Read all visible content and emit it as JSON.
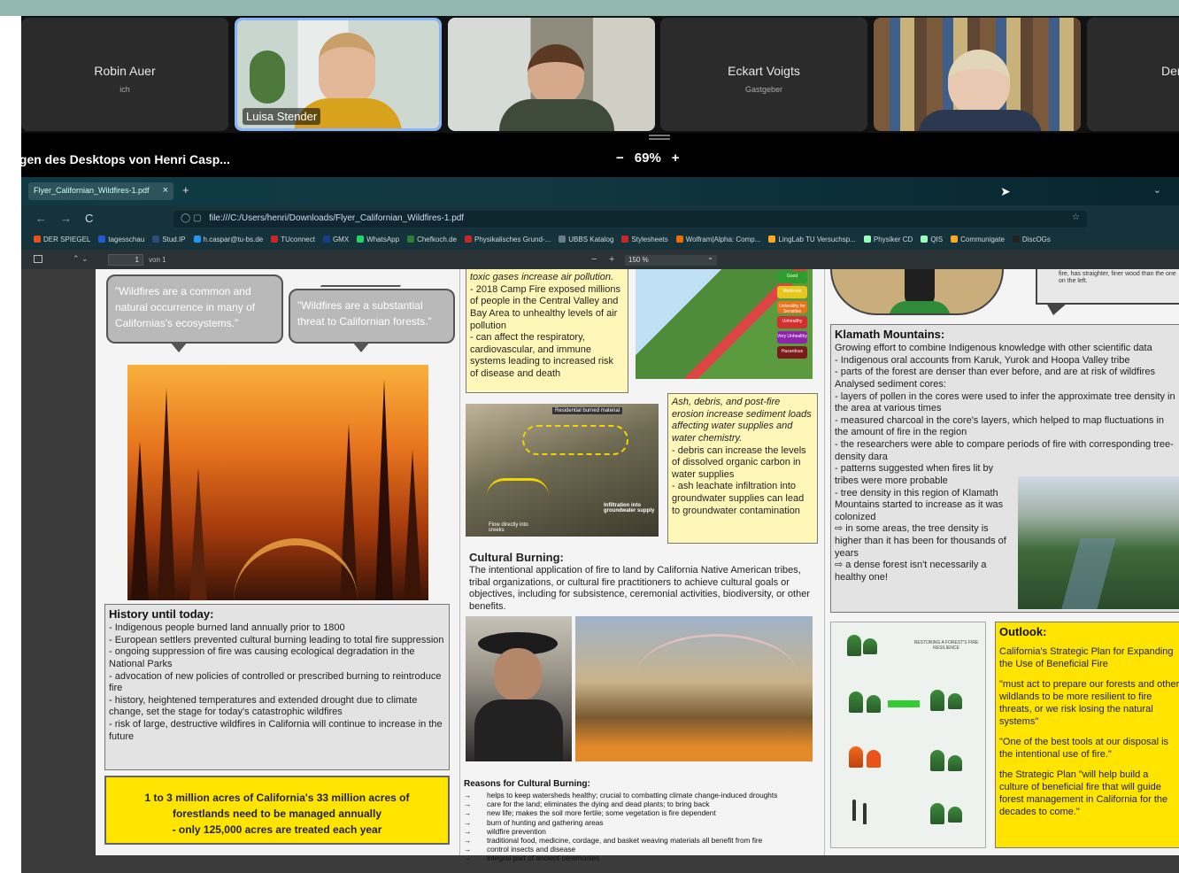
{
  "participants": [
    {
      "name": "Robin Auer",
      "role": "ich",
      "video": false
    },
    {
      "name": "Luisa Stender",
      "role": "",
      "video": true,
      "active": true
    },
    {
      "name": "",
      "role": "",
      "video": true
    },
    {
      "name": "Eckart Voigts",
      "role": "Gastgeber",
      "video": false
    },
    {
      "name": "",
      "role": "",
      "video": true
    },
    {
      "name": "Denn",
      "role": "",
      "video": false
    }
  ],
  "share": {
    "title": "igen des Desktops von Henri Casp...",
    "zoom_minus": "−",
    "zoom_value": "69%",
    "zoom_plus": "+"
  },
  "browser": {
    "tab_title": "Flyer_Californian_Wildfires-1.pdf",
    "tab_close": "×",
    "new_tab": "+",
    "url": "file:///C:/Users/henri/Downloads/Flyer_Californian_Wildfires-1.pdf",
    "back": "←",
    "forward": "→",
    "reload": "C",
    "bookmarks": [
      {
        "label": "DER SPIEGEL",
        "color": "#e0511e"
      },
      {
        "label": "tagesschau",
        "color": "#1e5bd6"
      },
      {
        "label": "Stud.IP",
        "color": "#2d4a7a"
      },
      {
        "label": "h.caspar@tu-bs.de",
        "color": "#2196f3"
      },
      {
        "label": "TUconnect",
        "color": "#c62828"
      },
      {
        "label": "GMX",
        "color": "#1a3c8b"
      },
      {
        "label": "WhatsApp",
        "color": "#25d366"
      },
      {
        "label": "Chefkoch.de",
        "color": "#2e7d32"
      },
      {
        "label": "Physikalisches Grund-...",
        "color": "#c62828"
      },
      {
        "label": "UBBS Katalog",
        "color": "#6b7d85"
      },
      {
        "label": "Stylesheets",
        "color": "#c62828"
      },
      {
        "label": "Wolfram|Alpha: Comp...",
        "color": "#ef6c00"
      },
      {
        "label": "LingLab TU Versuchsp...",
        "color": "#f9a825"
      },
      {
        "label": "Physiker CD",
        "color": "#9fb"
      },
      {
        "label": "QIS",
        "color": "#9fb"
      },
      {
        "label": "Communigate",
        "color": "#f9a825"
      },
      {
        "label": "DiscOGs",
        "color": "#222"
      }
    ]
  },
  "pdf_toolbar": {
    "page": "1",
    "page_of": "von 1",
    "zoom_minus": "−",
    "zoom_plus": "+",
    "zoom": "150 %"
  },
  "flyer": {
    "bubble1": "\"Wildfires are a common and natural occurrence in many of Californias's ecosystems.\"",
    "bubble2": "\"Wildfires are a substantial threat to Californian forests.\"",
    "history_title": "History until today:",
    "history_lines": [
      "- Indigenous people burned land annually prior to 1800",
      "- European settlers prevented cultural burning leading to total fire suppression",
      "- ongoing suppression of fire was causing ecological degradation in the National Parks",
      "- advocation of new policies of controlled or prescribed burning to reintroduce fire",
      "- history, heightened temperatures and extended drought due to climate change, set the stage for today's catastrophic wildfires",
      "- risk of large, destructive wildfires in California will continue to increase in the future"
    ],
    "acres_line1": "1 to 3 million acres of California's 33 million acres of",
    "acres_line2": "forestlands need to be managed annually",
    "acres_line3": "- only 125,000 acres are treated each year",
    "smoke_italic": "toxic gases increase air pollution.",
    "smoke_lines": [
      "- 2018 Camp Fire exposed millions of people in the Central Valley and Bay Area to unhealthy levels of air pollution",
      "- can affect the respiratory, cardiovascular, and immune systems leading to increased risk of disease and death"
    ],
    "residential_label": "Residential burned material",
    "flow_label": "Flow directly into creeks",
    "infiltration_label": "Infiltration into groundwater supply",
    "ash_italic": "Ash, debris, and post-fire erosion increase sediment loads affecting water supplies and water chemistry.",
    "ash_lines": [
      "- debris can increase the levels of dissolved organic carbon in water supplies",
      "- ash leachate infiltration into groundwater supplies can lead to groundwater contamination"
    ],
    "cultural_title": "Cultural Burning:",
    "cultural_text": "The intentional application of fire to land by California Native American tribes, tribal organizations, or cultural fire practitioners to achieve cultural goals or objectives, including for subsistence, ceremonial activities, biodiversity, or other benefits.",
    "reasons_title": "Reasons for Cultural Burning:",
    "reasons_arrow": "→",
    "reasons": [
      "helps to keep watersheds healthy; crucial to combatting climate change-induced droughts",
      "care for the land; eliminates the dying and dead plants; to bring back",
      "new life; makes the soil more fertile; some vegetation is fire dependent",
      "burn of hunting and gathering areas",
      "wildfire prevention",
      "traditional food, medicine, cordage, and basket weaving materials all benefit from fire",
      "control insects and disease",
      "integral part of ancient ceremonies"
    ],
    "top_right_note": "fire, has straighter, finer wood than the one on the left.",
    "klamath_title": "Klamath Mountains:",
    "klamath_lines": [
      "Growing effort to combine Indigenous knowledge with other scientific data",
      "- Indigenous oral accounts from Karuk, Yurok and Hoopa Valley tribe",
      "- parts of the forest are denser than ever before, and are at risk of wildfires",
      "Analysed sediment cores:",
      "- layers of pollen in the cores were used to infer the approximate tree density in the area at various times",
      "- measured charcoal in the core's layers, which helped to map fluctuations in the amount of fire in the region",
      "- the researchers were able to compare periods of fire with corresponding tree-density dara"
    ],
    "klamath_narrow": [
      "- patterns suggested when fires lit by tribes were more probable",
      "- tree density in this region of Klamath Mountains started to increase as it was colonized",
      "⇨ in some areas, the tree density is higher than it has been for thousands of years",
      "⇨ a dense forest isn't necessarily a healthy one!"
    ],
    "resilience_label": "RESTORING A FOREST'S FIRE RESILIENCE",
    "outlook_title": "Outlook:",
    "outlook_p1": "California's Strategic Plan for Expanding the Use of Beneficial Fire",
    "outlook_p2": "\"must act to prepare our forests and other wildlands to be more resilient to fire threats, or we risk losing the natural systems\"",
    "outlook_p3": "\"One of the best tools at our disposal is the intentional use of fire.\"",
    "outlook_p4": "the Strategic Plan \"will help build a culture of beneficial fire that will guide forest management in California for the decades to come.\"",
    "map_legend": [
      "Good",
      "Moderate",
      "Unhealthy for Sensitive",
      "Unhealthy",
      "Very Unhealthy",
      "Hazardous"
    ],
    "map_legend_colors": [
      "#2e9d2e",
      "#e7c61d",
      "#e8741e",
      "#d32f2f",
      "#8e24aa",
      "#7b1a1a"
    ]
  }
}
